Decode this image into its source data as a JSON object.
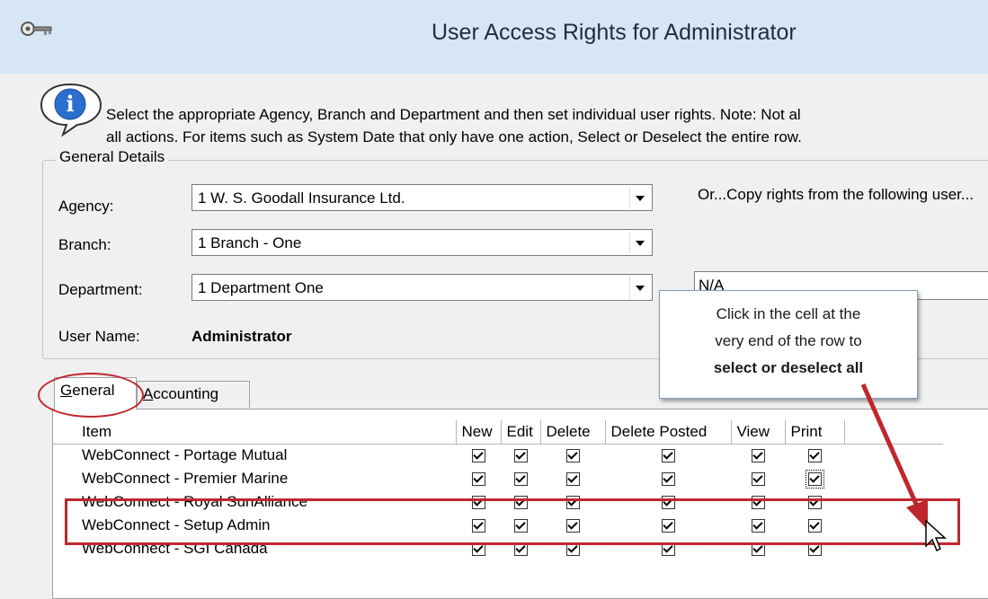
{
  "window": {
    "title": "User Access Rights for Administrator"
  },
  "info": {
    "line1": "Select the appropriate Agency, Branch and Department and then set individual user rights.  Note:  Not al",
    "line2": "all actions.  For items such as System Date that only have one action, Select or Deselect the entire row."
  },
  "general_details": {
    "title": "General Details",
    "agency_label": "Agency:",
    "agency_value": "1 W. S. Goodall Insurance Ltd.",
    "branch_label": "Branch:",
    "branch_value": "1 Branch - One",
    "department_label": "Department:",
    "department_value": "1 Department One",
    "username_label": "User Name:",
    "username_value": "Administrator",
    "copy_label": "Or...Copy rights from the following user...",
    "copy_value": "N/A"
  },
  "tabs": [
    {
      "label": "General",
      "mnemonic": "G",
      "rest": "eneral",
      "selected": true
    },
    {
      "label": "Accounting",
      "mnemonic": "A",
      "rest": "ccounting",
      "selected": false
    }
  ],
  "grid": {
    "columns": [
      "Item",
      "New",
      "Edit",
      "Delete",
      "Delete Posted",
      "View",
      "Print"
    ],
    "rows": [
      {
        "item": "WebConnect - Portage Mutual"
      },
      {
        "item": "WebConnect - Premier Marine"
      },
      {
        "item": "WebConnect - Royal SunAlliance"
      },
      {
        "item": "WebConnect - Setup Admin"
      },
      {
        "item": "WebConnect - SGI Canada"
      }
    ]
  },
  "callout": {
    "line1": "Click in the cell at the",
    "line2": "very end of the row to",
    "line3": "select or deselect all"
  },
  "colors": {
    "annotation_red": "#c0272d",
    "titlebar": "#d7e6f5"
  }
}
